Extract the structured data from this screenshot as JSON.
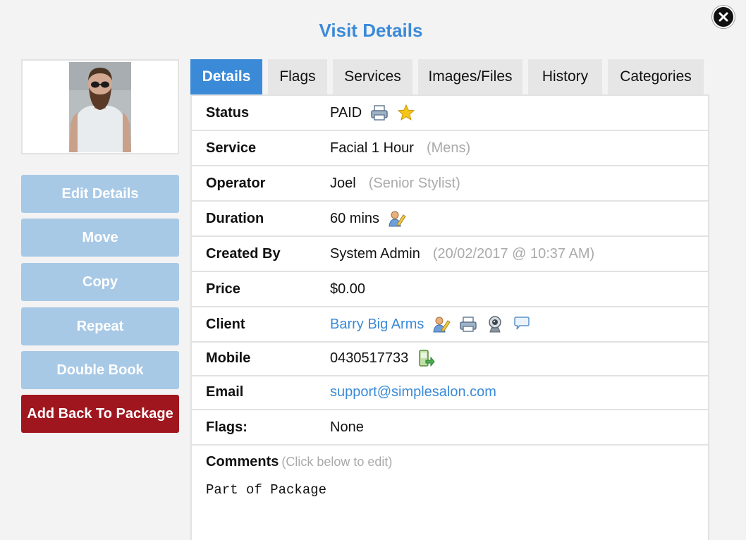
{
  "title": "Visit Details",
  "buttons": {
    "edit": "Edit Details",
    "move": "Move",
    "copy": "Copy",
    "repeat": "Repeat",
    "double_book": "Double Book",
    "add_back": "Add Back To Package"
  },
  "tabs": [
    "Details",
    "Flags",
    "Services",
    "Images/Files",
    "History",
    "Categories"
  ],
  "details": {
    "status": {
      "label": "Status",
      "value": "PAID"
    },
    "service": {
      "label": "Service",
      "value": "Facial 1 Hour",
      "sub": "(Mens)"
    },
    "operator": {
      "label": "Operator",
      "value": "Joel",
      "sub": "(Senior Stylist)"
    },
    "duration": {
      "label": "Duration",
      "value": "60 mins"
    },
    "created_by": {
      "label": "Created By",
      "value": "System Admin",
      "sub": "(20/02/2017 @ 10:37 AM)"
    },
    "price": {
      "label": "Price",
      "value": "$0.00"
    },
    "client": {
      "label": "Client",
      "value": "Barry Big Arms"
    },
    "mobile": {
      "label": "Mobile",
      "value": "0430517733"
    },
    "email": {
      "label": "Email",
      "value": "support@simplesalon.com"
    },
    "flags": {
      "label": "Flags:",
      "value": "None"
    }
  },
  "comments": {
    "label": "Comments",
    "hint": "(Click below to edit)",
    "text": "Part of Package"
  },
  "colors": {
    "accent": "#3b8ad8",
    "side_button": "#a8c9e6",
    "danger": "#a0161e"
  }
}
